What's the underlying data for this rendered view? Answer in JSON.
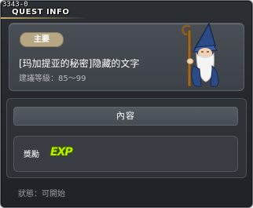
{
  "window": {
    "quest_id": "3343-0",
    "title": "QUEST INFO"
  },
  "quest": {
    "category": "主要",
    "name": "[玛加提亚的秘密]隐藏的文字",
    "level_range": "建議等級：85～99",
    "npc_icon": "old-wizard-npc-icon"
  },
  "content": {
    "header": "內容",
    "reward_label": "獎勵",
    "reward_icon": "EXP"
  },
  "status_text": "狀態：可開始",
  "colors": {
    "accent_gold": "#c7b06a",
    "badge": "#b6a684",
    "exp_green": "#b7f000"
  }
}
